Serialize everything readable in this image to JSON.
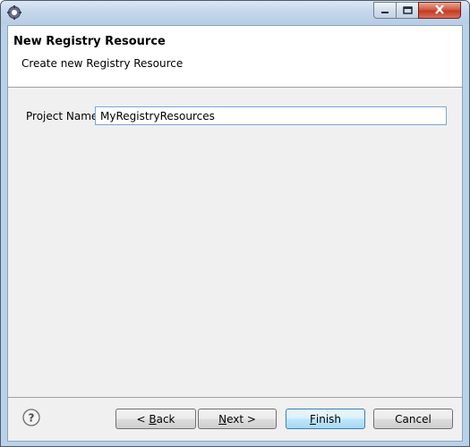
{
  "window": {
    "title_icon": "eclipse-gear-icon",
    "controls": {
      "minimize": "minimize-icon",
      "maximize": "maximize-icon",
      "close": "close-icon"
    }
  },
  "header": {
    "title": "New Registry Resource",
    "description": "Create new Registry Resource"
  },
  "form": {
    "project_name_label": "Project Name",
    "project_name_value": "MyRegistryResources"
  },
  "footer": {
    "help_icon": "help-icon",
    "back_prefix": "< ",
    "back_mnemonic": "B",
    "back_rest": "ack",
    "next_mnemonic": "N",
    "next_rest": "ext >",
    "finish_mnemonic": "F",
    "finish_rest": "inish",
    "cancel_label": "Cancel"
  },
  "colors": {
    "frame": "#b9d1ea",
    "dialog_bg": "#f0f0f0",
    "header_bg": "#ffffff",
    "default_button": "#3c7fb1"
  }
}
